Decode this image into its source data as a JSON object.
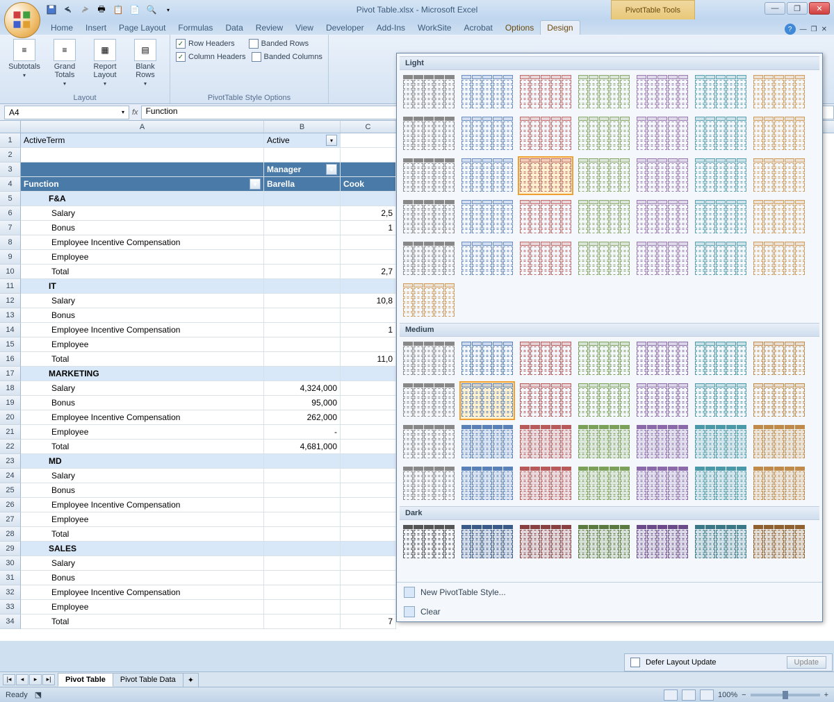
{
  "title": "Pivot Table.xlsx - Microsoft Excel",
  "tooltab": "PivotTable Tools",
  "tabs": [
    "Home",
    "Insert",
    "Page Layout",
    "Formulas",
    "Data",
    "Review",
    "View",
    "Developer",
    "Add-Ins",
    "WorkSite",
    "Acrobat"
  ],
  "context_tabs": [
    "Options",
    "Design"
  ],
  "active_tab": "Design",
  "ribbon": {
    "layout_group": "Layout",
    "subtotals": "Subtotals",
    "grand_totals": "Grand Totals",
    "report_layout": "Report Layout",
    "blank_rows": "Blank Rows",
    "style_options_group": "PivotTable Style Options",
    "row_headers": "Row Headers",
    "column_headers": "Column Headers",
    "banded_rows": "Banded Rows",
    "banded_columns": "Banded Columns"
  },
  "namebox": "A4",
  "formula": "Function",
  "columns": [
    "A",
    "B",
    "C"
  ],
  "pivot": {
    "active_term_label": "ActiveTerm",
    "active_term_value": "Active",
    "manager_label": "Manager",
    "function_label": "Function",
    "managers": [
      "Barella",
      "Cook"
    ]
  },
  "rows": [
    {
      "n": 1,
      "a": "ActiveTerm",
      "b": "Active",
      "filter_a": false,
      "filter_b": true,
      "style": "filter"
    },
    {
      "n": 2
    },
    {
      "n": 3,
      "b": "Manager",
      "style": "hdr",
      "drop_b": true
    },
    {
      "n": 4,
      "a": "Function",
      "b": "Barella",
      "c": "Cook",
      "style": "hdr",
      "drop_a": true
    },
    {
      "n": 5,
      "a": "F&A",
      "style": "section"
    },
    {
      "n": 6,
      "a": "Salary",
      "c": "2,5",
      "indent": true
    },
    {
      "n": 7,
      "a": "Bonus",
      "c": "1",
      "indent": true
    },
    {
      "n": 8,
      "a": "Employee Incentive Compensation",
      "indent": true
    },
    {
      "n": 9,
      "a": "Employee",
      "indent": true
    },
    {
      "n": 10,
      "a": "Total",
      "c": "2,7",
      "indent": true
    },
    {
      "n": 11,
      "a": "IT",
      "style": "section"
    },
    {
      "n": 12,
      "a": "Salary",
      "c": "10,8",
      "indent": true
    },
    {
      "n": 13,
      "a": "Bonus",
      "indent": true
    },
    {
      "n": 14,
      "a": "Employee Incentive Compensation",
      "c": "1",
      "indent": true
    },
    {
      "n": 15,
      "a": "Employee",
      "indent": true
    },
    {
      "n": 16,
      "a": "Total",
      "c": "11,0",
      "indent": true
    },
    {
      "n": 17,
      "a": "MARKETING",
      "style": "section"
    },
    {
      "n": 18,
      "a": "Salary",
      "b": "4,324,000",
      "indent": true
    },
    {
      "n": 19,
      "a": "Bonus",
      "b": "95,000",
      "indent": true
    },
    {
      "n": 20,
      "a": "Employee Incentive Compensation",
      "b": "262,000",
      "indent": true
    },
    {
      "n": 21,
      "a": "Employee",
      "b": "-",
      "indent": true
    },
    {
      "n": 22,
      "a": "Total",
      "b": "4,681,000",
      "indent": true
    },
    {
      "n": 23,
      "a": "MD",
      "style": "section"
    },
    {
      "n": 24,
      "a": "Salary",
      "indent": true
    },
    {
      "n": 25,
      "a": "Bonus",
      "indent": true
    },
    {
      "n": 26,
      "a": "Employee Incentive Compensation",
      "indent": true
    },
    {
      "n": 27,
      "a": "Employee",
      "indent": true
    },
    {
      "n": 28,
      "a": "Total",
      "indent": true
    },
    {
      "n": 29,
      "a": "SALES",
      "style": "section"
    },
    {
      "n": 30,
      "a": "Salary",
      "indent": true
    },
    {
      "n": 31,
      "a": "Bonus",
      "indent": true
    },
    {
      "n": 32,
      "a": "Employee Incentive Compensation",
      "indent": true
    },
    {
      "n": 33,
      "a": "Employee",
      "indent": true
    },
    {
      "n": 34,
      "a": "Total",
      "c": "7",
      "indent": true
    }
  ],
  "gallery": {
    "sections": [
      "Light",
      "Medium",
      "Dark"
    ],
    "new_style": "New PivotTable Style...",
    "clear": "Clear",
    "light_colors": [
      "#888",
      "#6a8cc0",
      "#c06a6a",
      "#8aa86a",
      "#9a7ab0",
      "#5aa0b0",
      "#d09a5a"
    ],
    "medium_colors": [
      "#888",
      "#5a80b8",
      "#b85a5a",
      "#7aa05a",
      "#8a6aa8",
      "#4a98a8",
      "#c08a4a"
    ],
    "dark_colors": [
      "#555",
      "#3a5a88",
      "#884040",
      "#5a7a40",
      "#6a4a88",
      "#3a7888",
      "#906030"
    ]
  },
  "sheets": [
    "Pivot Table",
    "Pivot Table Data"
  ],
  "active_sheet": "Pivot Table",
  "status": "Ready",
  "zoom": "100%",
  "defer": "Defer Layout Update",
  "update_btn": "Update"
}
